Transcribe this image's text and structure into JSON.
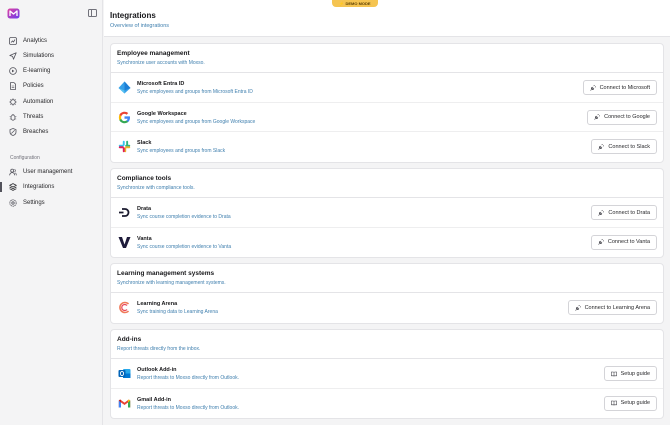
{
  "demo_badge": "⚡ DEMO MODE",
  "sidebar": {
    "items": [
      {
        "label": "Analytics",
        "icon": "analytics-icon"
      },
      {
        "label": "Simulations",
        "icon": "simulations-icon"
      },
      {
        "label": "E-learning",
        "icon": "e-learning-icon"
      },
      {
        "label": "Policies",
        "icon": "policies-icon"
      },
      {
        "label": "Automation",
        "icon": "automation-icon"
      },
      {
        "label": "Threats",
        "icon": "threats-icon"
      },
      {
        "label": "Breaches",
        "icon": "breaches-icon"
      }
    ],
    "section_label": "Configuration",
    "config_items": [
      {
        "label": "User management",
        "icon": "users-icon"
      },
      {
        "label": "Integrations",
        "icon": "integrations-icon",
        "active": true
      },
      {
        "label": "Settings",
        "icon": "settings-icon"
      }
    ]
  },
  "header": {
    "title": "Integrations",
    "subtitle": "Overview of integrations"
  },
  "cards": [
    {
      "title": "Employee management",
      "subtitle": "Synchronize user accounts with Moxso.",
      "rows": [
        {
          "name": "Microsoft Entra ID",
          "desc": "Sync employees and groups from Microsoft Entra ID",
          "button": "Connect to Microsoft",
          "logo": "microsoft-entra-logo"
        },
        {
          "name": "Google Workspace",
          "desc": "Sync employees and groups from Google Workspace",
          "button": "Connect to Google",
          "logo": "google-logo"
        },
        {
          "name": "Slack",
          "desc": "Sync employees and groups from Slack",
          "button": "Connect to Slack",
          "logo": "slack-logo"
        }
      ]
    },
    {
      "title": "Compliance tools",
      "subtitle": "Synchronize with compliance tools.",
      "rows": [
        {
          "name": "Drata",
          "desc": "Sync course completion evidence to Drata",
          "button": "Connect to Drata",
          "logo": "drata-logo"
        },
        {
          "name": "Vanta",
          "desc": "Sync course completion evidence to Vanta",
          "button": "Connect to Vanta",
          "logo": "vanta-logo"
        }
      ]
    },
    {
      "title": "Learning management systems",
      "subtitle": "Synchronize with learning management systems.",
      "rows": [
        {
          "name": "Learning Arena",
          "desc": "Sync training data to Learning Arena",
          "button": "Connect to Learning Arena",
          "logo": "learning-arena-logo"
        }
      ]
    },
    {
      "title": "Add-ins",
      "subtitle": "Report threats directly from the inbox.",
      "rows": [
        {
          "name": "Outlook Add-in",
          "desc": "Report threats to Moxso directly from Outlook.",
          "button": "Setup guide",
          "logo": "outlook-logo"
        },
        {
          "name": "Gmail Add-in",
          "desc": "Report threats to Moxso directly from Outlook.",
          "button": "Setup guide",
          "logo": "gmail-logo"
        }
      ]
    }
  ],
  "colors": {
    "accent_link": "#3f7fae",
    "demo_badge": "#f5c451"
  }
}
